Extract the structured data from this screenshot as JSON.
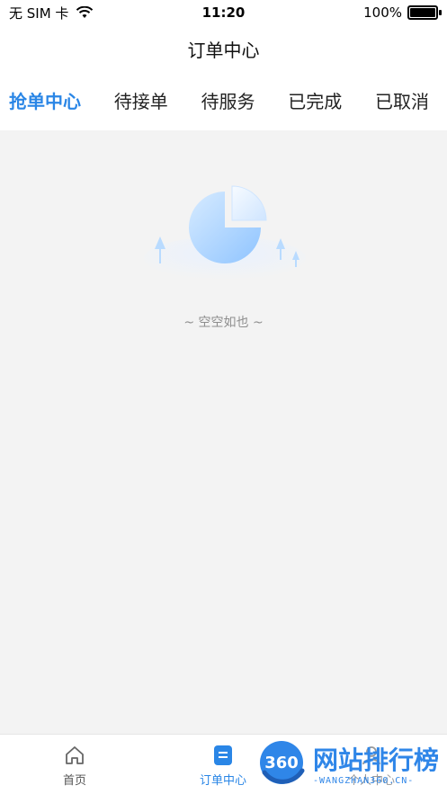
{
  "status_bar": {
    "carrier": "无 SIM 卡",
    "time": "11:20",
    "battery_percent": "100%",
    "battery_level": 1.0
  },
  "header": {
    "title": "订单中心"
  },
  "tabs": [
    {
      "label": "抢单中心",
      "active": true
    },
    {
      "label": "待接单",
      "active": false
    },
    {
      "label": "待服务",
      "active": false
    },
    {
      "label": "已完成",
      "active": false
    },
    {
      "label": "已取消",
      "active": false
    }
  ],
  "empty_state": {
    "text": "~ 空空如也 ~"
  },
  "bottom_nav": {
    "home_label": "首页",
    "orders_label": "订单中心",
    "profile_label": "个人中心"
  },
  "watermark": {
    "badge": "360",
    "title": "网站排行榜",
    "url": "-WANGZHAN360.CN-"
  },
  "colors": {
    "accent": "#2a86e6",
    "background": "#f3f3f3"
  }
}
